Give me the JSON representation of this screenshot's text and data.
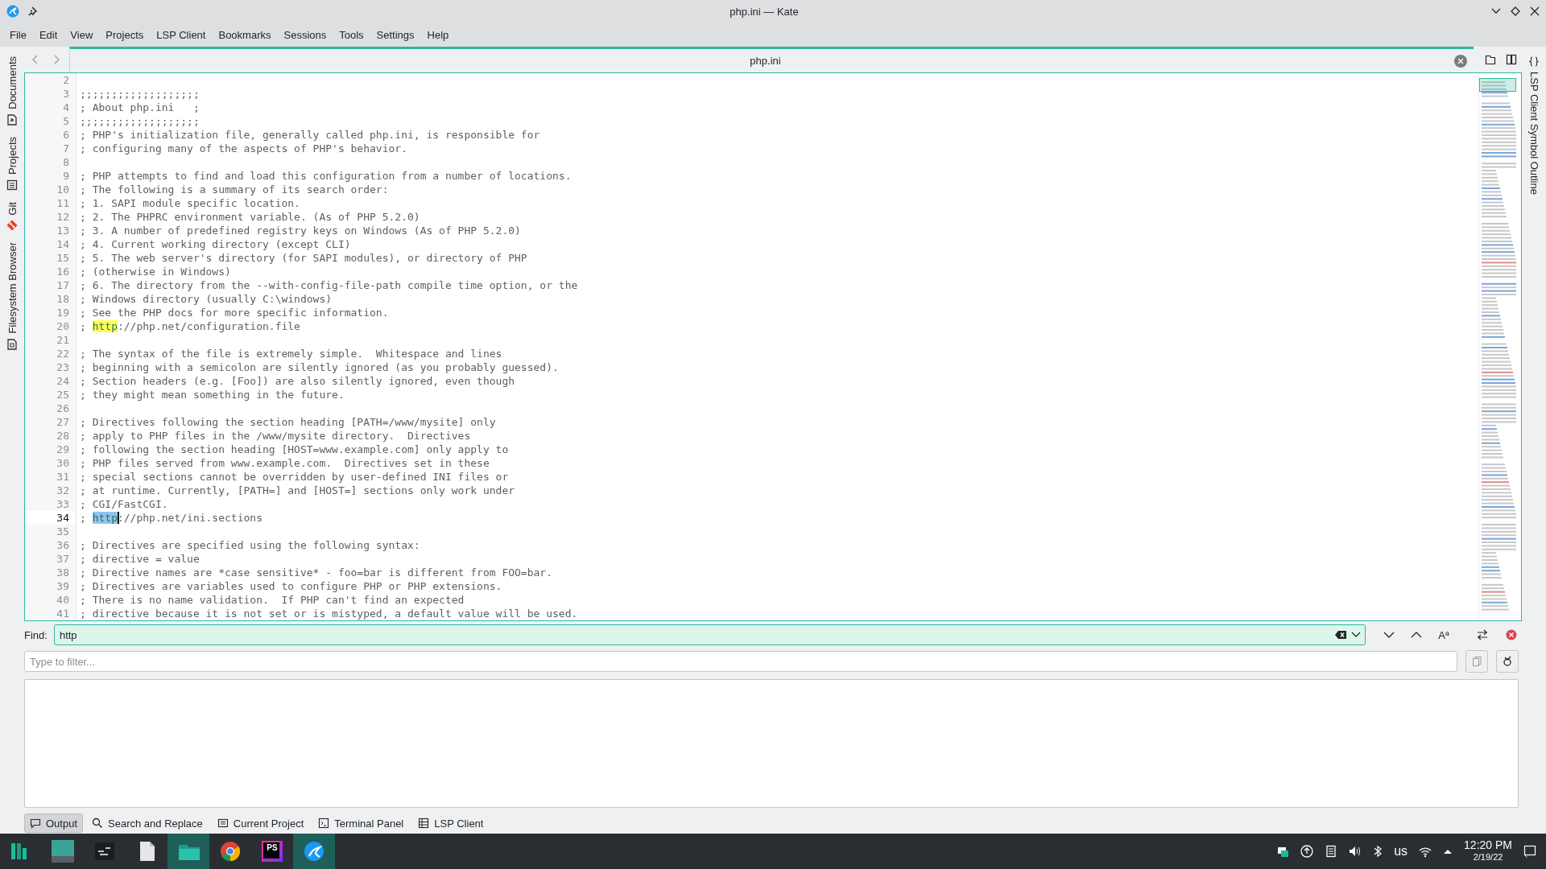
{
  "window": {
    "title": "php.ini — Kate"
  },
  "menu": [
    "File",
    "Edit",
    "View",
    "Projects",
    "LSP Client",
    "Bookmarks",
    "Sessions",
    "Tools",
    "Settings",
    "Help"
  ],
  "left_sidebar": [
    {
      "label": "Documents",
      "kind": "documents",
      "selected": false
    },
    {
      "label": "Projects",
      "kind": "projects",
      "selected": false
    },
    {
      "label": "Git",
      "kind": "git",
      "selected": false
    },
    {
      "label": "Filesystem Browser",
      "kind": "filesystem",
      "selected": false
    }
  ],
  "right_sidebar": [
    {
      "label": "LSP Client Symbol Outline",
      "selected": false
    }
  ],
  "tab": {
    "label": "php.ini"
  },
  "lines": [
    {
      "number": "2",
      "current": false
    },
    {
      "number": "3",
      "current": false,
      "text": ";;;;;;;;;;;;;;;;;;;"
    },
    {
      "number": "4",
      "current": false,
      "text": "; About php.ini   ;"
    },
    {
      "number": "5",
      "current": false,
      "text": ";;;;;;;;;;;;;;;;;;;"
    },
    {
      "number": "6",
      "current": false,
      "text": "; PHP's initialization file, generally called php.ini, is responsible for"
    },
    {
      "number": "7",
      "current": false,
      "text": "; configuring many of the aspects of PHP's behavior."
    },
    {
      "number": "8",
      "current": false
    },
    {
      "number": "9",
      "current": false,
      "text": "; PHP attempts to find and load this configuration from a number of locations."
    },
    {
      "number": "10",
      "current": false,
      "text": "; The following is a summary of its search order:"
    },
    {
      "number": "11",
      "current": false,
      "text": "; 1. SAPI module specific location."
    },
    {
      "number": "12",
      "current": false,
      "text": "; 2. The PHPRC environment variable. (As of PHP 5.2.0)"
    },
    {
      "number": "13",
      "current": false,
      "text": "; 3. A number of predefined registry keys on Windows (As of PHP 5.2.0)"
    },
    {
      "number": "14",
      "current": false,
      "text": "; 4. Current working directory (except CLI)"
    },
    {
      "number": "15",
      "current": false,
      "text": "; 5. The web server's directory (for SAPI modules), or directory of PHP"
    },
    {
      "number": "16",
      "current": false,
      "text": "; (otherwise in Windows)"
    },
    {
      "number": "17",
      "current": false,
      "text": "; 6. The directory from the --with-config-file-path compile time option, or the"
    },
    {
      "number": "18",
      "current": false,
      "text": "; Windows directory (usually C:\\windows)"
    },
    {
      "number": "19",
      "current": false,
      "text": "; See the PHP docs for more specific information."
    },
    {
      "number": "20",
      "current": false,
      "segments": [
        {
          "kind": "plain",
          "text": "; "
        },
        {
          "kind": "match",
          "text": "http"
        },
        {
          "kind": "plain",
          "text": "://php.net/configuration.file"
        }
      ]
    },
    {
      "number": "21",
      "current": false
    },
    {
      "number": "22",
      "current": false,
      "text": "; The syntax of the file is extremely simple.  Whitespace and lines"
    },
    {
      "number": "23",
      "current": false,
      "text": "; beginning with a semicolon are silently ignored (as you probably guessed)."
    },
    {
      "number": "24",
      "current": false,
      "text": "; Section headers (e.g. [Foo]) are also silently ignored, even though"
    },
    {
      "number": "25",
      "current": false,
      "text": "; they might mean something in the future."
    },
    {
      "number": "26",
      "current": false
    },
    {
      "number": "27",
      "current": false,
      "text": "; Directives following the section heading [PATH=/www/mysite] only"
    },
    {
      "number": "28",
      "current": false,
      "text": "; apply to PHP files in the /www/mysite directory.  Directives"
    },
    {
      "number": "29",
      "current": false,
      "text": "; following the section heading [HOST=www.example.com] only apply to"
    },
    {
      "number": "30",
      "current": false,
      "text": "; PHP files served from www.example.com.  Directives set in these"
    },
    {
      "number": "31",
      "current": false,
      "text": "; special sections cannot be overridden by user-defined INI files or"
    },
    {
      "number": "32",
      "current": false,
      "text": "; at runtime. Currently, [PATH=] and [HOST=] sections only work under"
    },
    {
      "number": "33",
      "current": false,
      "text": "; CGI/FastCGI."
    },
    {
      "number": "34",
      "current": true,
      "segments": [
        {
          "kind": "plain",
          "text": "; "
        },
        {
          "kind": "selected",
          "text": "http"
        },
        {
          "kind": "plain",
          "text": "://php.net/ini.sections"
        }
      ]
    },
    {
      "number": "35",
      "current": false
    },
    {
      "number": "36",
      "current": false,
      "text": "; Directives are specified using the following syntax:"
    },
    {
      "number": "37",
      "current": false,
      "text": "; directive = value"
    },
    {
      "number": "38",
      "current": false,
      "text": "; Directive names are *case sensitive* - foo=bar is different from FOO=bar."
    },
    {
      "number": "39",
      "current": false,
      "text": "; Directives are variables used to configure PHP or PHP extensions."
    },
    {
      "number": "40",
      "current": false,
      "text": "; There is no name validation.  If PHP can't find an expected"
    },
    {
      "number": "41",
      "current": false,
      "text": "; directive because it is not set or is mistyped, a default value will be used."
    }
  ],
  "find": {
    "label": "Find:",
    "value": "http",
    "match_case_label": "Aª"
  },
  "filter": {
    "placeholder": "Type to filter..."
  },
  "bottom_tabs": [
    {
      "label": "Output",
      "kind": "output",
      "selected": true
    },
    {
      "label": "Search and Replace",
      "kind": "search",
      "selected": false
    },
    {
      "label": "Current Project",
      "kind": "project",
      "selected": false
    },
    {
      "label": "Terminal Panel",
      "kind": "terminal",
      "selected": false
    },
    {
      "label": "LSP Client",
      "kind": "lsp",
      "selected": false
    }
  ],
  "taskbar": {
    "apps": [
      {
        "kind": "launcher",
        "active": false
      },
      {
        "kind": "desktop",
        "active": false
      },
      {
        "kind": "terminal",
        "active": false
      },
      {
        "kind": "document",
        "active": false
      },
      {
        "kind": "folder",
        "active": true
      },
      {
        "kind": "browser",
        "active": false
      },
      {
        "kind": "ide",
        "active": false,
        "label": "PS"
      },
      {
        "kind": "editor",
        "active": true
      }
    ],
    "keyboard_layout": "us",
    "time": "12:20 PM",
    "date": "2/19/22"
  }
}
